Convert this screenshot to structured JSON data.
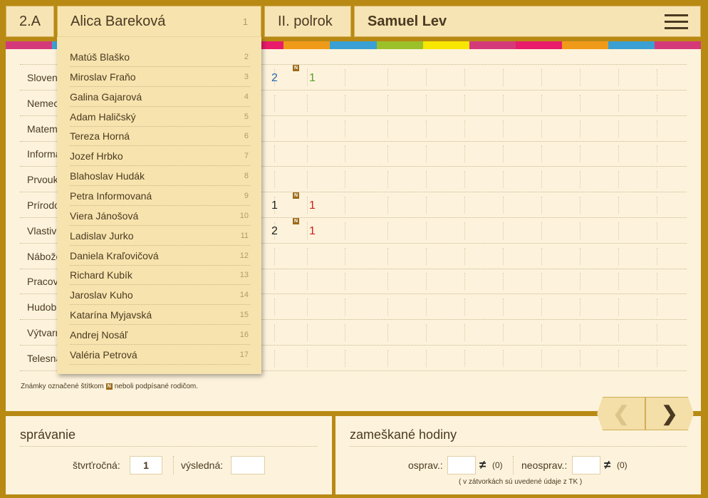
{
  "header": {
    "class_label": "2.A",
    "selected_student": "Alica Bareková",
    "selected_number": "1",
    "semester": "II. polrok",
    "teacher": "Samuel Lev"
  },
  "subjects": [
    "Slovenský jazyk",
    "Nemecký jazyk",
    "Matematika",
    "Informatická výchova",
    "Prvouka",
    "Prírodoveda",
    "Vlastiveda",
    "Náboženská výchova",
    "Pracovné vyučovanie",
    "Hudobná výchova",
    "Výtvarná výchova",
    "Telesná výchova"
  ],
  "grades": [
    {
      "row": 0,
      "items": [
        {
          "value": "2",
          "color": "#2a6ab5"
        },
        {
          "value": "1",
          "color": "#58a028",
          "badge": "N"
        }
      ]
    },
    {
      "row": 5,
      "items": [
        {
          "value": "1",
          "color": "#222222"
        },
        {
          "value": "1",
          "color": "#cc2020",
          "badge": "N"
        }
      ]
    },
    {
      "row": 6,
      "items": [
        {
          "value": "2",
          "color": "#222222"
        },
        {
          "value": "1",
          "color": "#cc2020",
          "badge": "N"
        }
      ]
    }
  ],
  "note": {
    "before": "Známky označené štítkom",
    "badge": "N",
    "after": "neboli podpísané rodičom."
  },
  "students": [
    {
      "name": "Matúš Blaško",
      "num": "2"
    },
    {
      "name": "Miroslav Fraňo",
      "num": "3"
    },
    {
      "name": "Galina Gajarová",
      "num": "4"
    },
    {
      "name": "Adam Haličský",
      "num": "5"
    },
    {
      "name": "Tereza Horná",
      "num": "6"
    },
    {
      "name": "Jozef Hrbko",
      "num": "7"
    },
    {
      "name": "Blahoslav Hudák",
      "num": "8"
    },
    {
      "name": "Petra Informovaná",
      "num": "9"
    },
    {
      "name": "Viera Jánošová",
      "num": "10"
    },
    {
      "name": "Ladislav Jurko",
      "num": "11"
    },
    {
      "name": "Daniela Kraľovičová",
      "num": "12"
    },
    {
      "name": "Richard Kubík",
      "num": "13"
    },
    {
      "name": "Jaroslav Kuho",
      "num": "14"
    },
    {
      "name": "Katarína Myjavská",
      "num": "15"
    },
    {
      "name": "Andrej Nosáľ",
      "num": "16"
    },
    {
      "name": "Valéria Petrová",
      "num": "17"
    }
  ],
  "behavior": {
    "title": "správanie",
    "quarter_label": "štvrťročná:",
    "quarter_value": "1",
    "final_label": "výsledná:",
    "final_value": ""
  },
  "absence": {
    "title": "zameškané hodiny",
    "excused_label": "osprav.:",
    "excused_value": "",
    "excused_tk": "(0)",
    "unexcused_label": "neosprav.:",
    "unexcused_value": "",
    "unexcused_tk": "(0)",
    "footnote": "( v zátvorkách sú uvedené údaje z TK )"
  },
  "nav": {
    "prev": "❮",
    "next": "❯"
  },
  "colors": {
    "stripe": [
      "#d43a7a",
      "#3aa0d4",
      "#9bc02a",
      "#f2dc1a",
      "#d43a7a",
      "#e81c6a",
      "#f09a1a",
      "#3aa0d4",
      "#9bc02a",
      "#f7e600",
      "#d43a7a",
      "#e81c6a",
      "#f09a1a",
      "#3aa0d4",
      "#d43a7a"
    ]
  }
}
